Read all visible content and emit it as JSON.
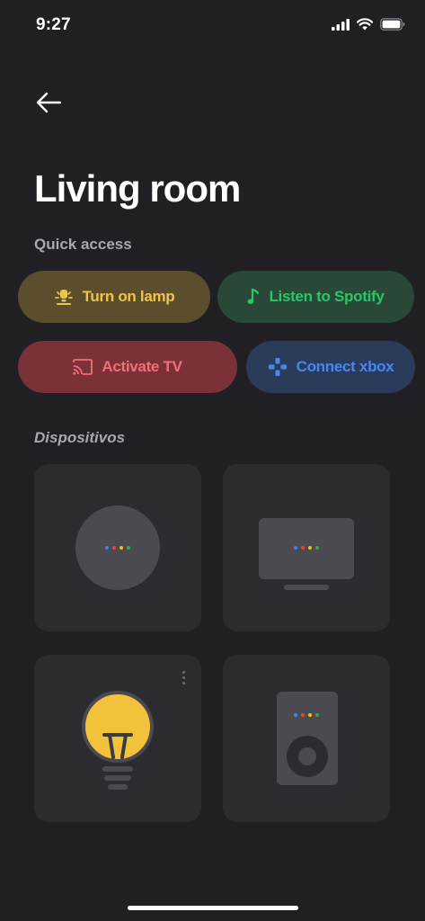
{
  "status_bar": {
    "time": "9:27"
  },
  "header": {
    "title": "Living room"
  },
  "quick_access": {
    "label": "Quick access",
    "actions": [
      {
        "label": "Turn on lamp",
        "icon": "lamp-icon",
        "color": "#f0c44a",
        "bg": "#5a4e2c"
      },
      {
        "label": "Listen to Spotify",
        "icon": "music-note-icon",
        "color": "#2dc467",
        "bg": "#2a4838"
      },
      {
        "label": "Activate TV",
        "icon": "cast-icon",
        "color": "#f0707a",
        "bg": "#7a3138"
      },
      {
        "label": "Connect xbox",
        "icon": "gamepad-icon",
        "color": "#4a86ee",
        "bg": "#2a3c5a"
      }
    ]
  },
  "devices": {
    "label": "Dispositivos",
    "items": [
      {
        "type": "smart-speaker-mini",
        "icon": "smart-speaker-icon"
      },
      {
        "type": "smart-display",
        "icon": "smart-display-icon"
      },
      {
        "type": "smart-bulb",
        "icon": "light-bulb-icon",
        "color": "#f2c23c"
      },
      {
        "type": "smart-speaker",
        "icon": "speaker-icon"
      }
    ]
  },
  "google_dot_colors": [
    "#4285f4",
    "#ea4335",
    "#fbbc05",
    "#34a853"
  ]
}
